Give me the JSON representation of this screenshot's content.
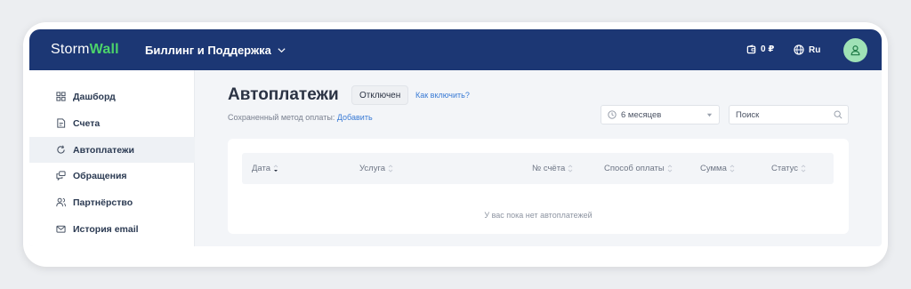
{
  "header": {
    "logo_part1": "Storm",
    "logo_part2": "Wall",
    "section": "Биллинг и Поддержка",
    "balance": "0 ₽",
    "language": "Ru"
  },
  "sidebar": {
    "items": [
      {
        "label": "Дашборд",
        "icon": "dashboard-icon"
      },
      {
        "label": "Счета",
        "icon": "invoice-icon"
      },
      {
        "label": "Автоплатежи",
        "icon": "refresh-icon",
        "active": true
      },
      {
        "label": "Обращения",
        "icon": "chat-icon"
      },
      {
        "label": "Партнёрство",
        "icon": "partners-icon"
      },
      {
        "label": "История email",
        "icon": "mail-icon"
      }
    ]
  },
  "page": {
    "title": "Автоплатежи",
    "status": "Отключен",
    "howto": "Как включить?",
    "saved_label": "Сохраненный метод оплаты:",
    "saved_action": "Добавить"
  },
  "filters": {
    "period": "6 месяцев",
    "search_placeholder": "Поиск"
  },
  "table": {
    "columns": [
      "Дата",
      "Услуга",
      "№ счёта",
      "Способ оплаты",
      "Сумма",
      "Статус"
    ],
    "empty_text": "У вас пока нет автоплатежей"
  },
  "colors": {
    "header_bg": "#1c3774",
    "logo_accent": "#4cd36a",
    "link": "#3a7bd5",
    "avatar_bg": "#9fe2b6"
  }
}
